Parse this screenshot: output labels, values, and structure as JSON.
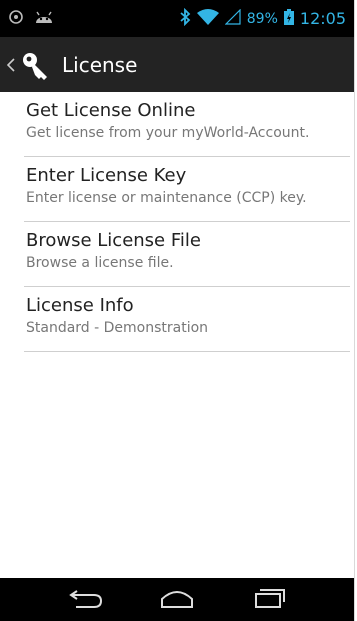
{
  "status_bar": {
    "battery_percent": "89%",
    "time": "12:05",
    "icons": [
      "settings-icon",
      "android-icon",
      "bluetooth-icon",
      "wifi-icon",
      "signal-icon",
      "battery-icon"
    ]
  },
  "action_bar": {
    "title": "License",
    "icons": [
      "back-chevron-icon",
      "key-icon"
    ]
  },
  "items": [
    {
      "title": "Get License Online",
      "subtitle": "Get license from your myWorld-Account."
    },
    {
      "title": "Enter License Key",
      "subtitle": "Enter license or maintenance (CCP) key."
    },
    {
      "title": "Browse License File",
      "subtitle": "Browse a license file."
    },
    {
      "title": "License Info",
      "subtitle": "Standard - Demonstration"
    }
  ],
  "nav_bar": {
    "icons": [
      "back-icon",
      "home-icon",
      "recent-apps-icon"
    ]
  },
  "colors": {
    "status_bg": "#000000",
    "actionbar_bg": "#232323",
    "holo_blue": "#33b5e5",
    "divider": "#cfcfcf"
  }
}
